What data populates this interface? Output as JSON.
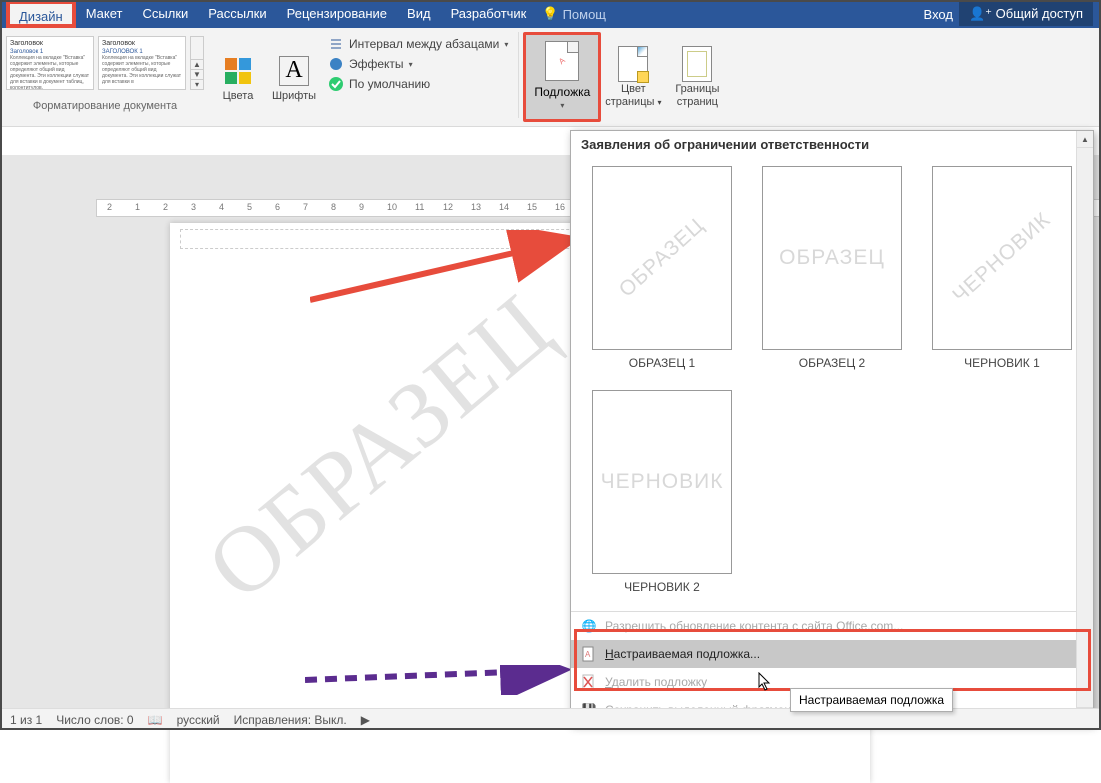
{
  "menubar": {
    "tabs": [
      "Дизайн",
      "Макет",
      "Ссылки",
      "Рассылки",
      "Рецензирование",
      "Вид",
      "Разработчик"
    ],
    "help": "Помощ",
    "login": "Вход",
    "share": "Общий доступ"
  },
  "ribbon": {
    "style1_title": "Заголовок",
    "style1_sub": "Заголовок 1",
    "style1_body": "Коллекция на вкладке \"Вставка\" содержит элементы, которые определяют общий вид документа. Эти коллекции служат для вставки в документ таблиц, колонтитулов.",
    "style2_title": "Заголовок",
    "style2_sub": "ЗАГОЛОВОК 1",
    "style2_body": "Коллекция на вкладке \"Вставка\" содержит элементы, которые определяют общий вид документа. Эти коллекции служат для вставки в",
    "group_formatting": "Форматирование документа",
    "colors": "Цвета",
    "fonts": "Шрифты",
    "paragraph_spacing": "Интервал между абзацами",
    "effects": "Эффекты",
    "default": "По умолчанию",
    "watermark_btn": "Подложка",
    "page_color": "Цвет страницы",
    "page_borders": "Границы страниц"
  },
  "document": {
    "watermark_text": "ОБРАЗЕЦ"
  },
  "gallery": {
    "header": "Заявления об ограничении ответственности",
    "items": [
      {
        "wm": "ОБРАЗЕЦ",
        "cap": "ОБРАЗЕЦ 1",
        "diag": true
      },
      {
        "wm": "ОБРАЗЕЦ",
        "cap": "ОБРАЗЕЦ 2",
        "diag": false
      },
      {
        "wm": "ЧЕРНОВИК",
        "cap": "ЧЕРНОВИК 1",
        "diag": true
      },
      {
        "wm": "ЧЕРНОВИК",
        "cap": "ЧЕРНОВИК 2",
        "diag": false
      }
    ],
    "menu": {
      "office": "Разрешить обновление контента с сайта Office.com...",
      "custom": "Настраиваемая подложка...",
      "delete": "Удалить подложку",
      "save_sel": "Сохранить выделенный фрагмент в коллекцию подложек..."
    }
  },
  "tooltip": "Настраиваемая подложка",
  "status": {
    "page": "1 из 1",
    "words": "Число слов: 0",
    "lang": "русский",
    "track": "Исправления: Выкл."
  },
  "ruler_marks": [
    "2",
    "1",
    "2",
    "3",
    "4",
    "5",
    "6",
    "7",
    "8",
    "9",
    "10",
    "11",
    "12",
    "13",
    "14",
    "15",
    "16"
  ]
}
